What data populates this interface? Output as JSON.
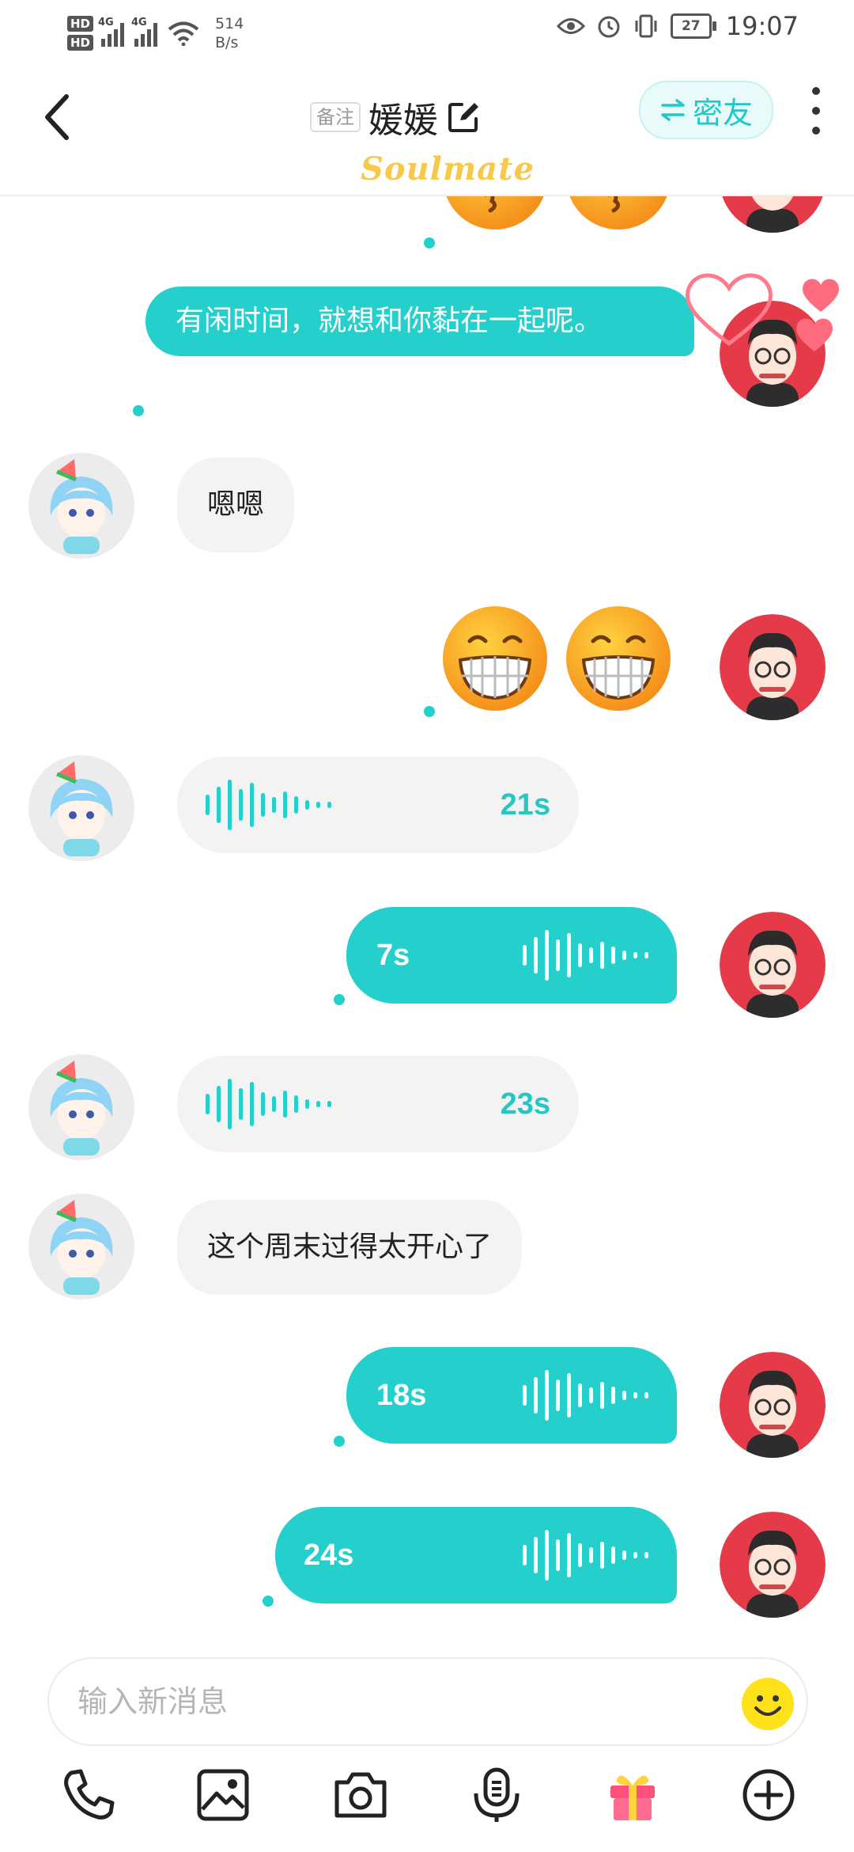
{
  "status_bar": {
    "hd1": "HD",
    "hd2": "HD",
    "net1": "4G",
    "net2": "4G",
    "speed_value": "514",
    "speed_unit": "B/s",
    "battery": "27",
    "time": "19:07"
  },
  "header": {
    "remark_tag": "备注",
    "title": "媛媛",
    "mi_button": "密友",
    "brand": "Soulmate"
  },
  "messages": {
    "m1": "有闲时间，就想和你黏在一起呢。",
    "m2": "嗯嗯",
    "v1": "21s",
    "v2": "7s",
    "v3": "23s",
    "m3": "这个周末过得太开心了",
    "v4": "18s",
    "v5": "24s"
  },
  "input": {
    "placeholder": "输入新消息"
  },
  "toolbar": [
    "phone-icon",
    "image-icon",
    "camera-icon",
    "voice-mic-icon",
    "gift-icon",
    "plus-icon"
  ],
  "colors": {
    "accent": "#25d0cc",
    "incoming_bubble": "#f3f3f3",
    "brand_yellow": "#f6c94a"
  }
}
